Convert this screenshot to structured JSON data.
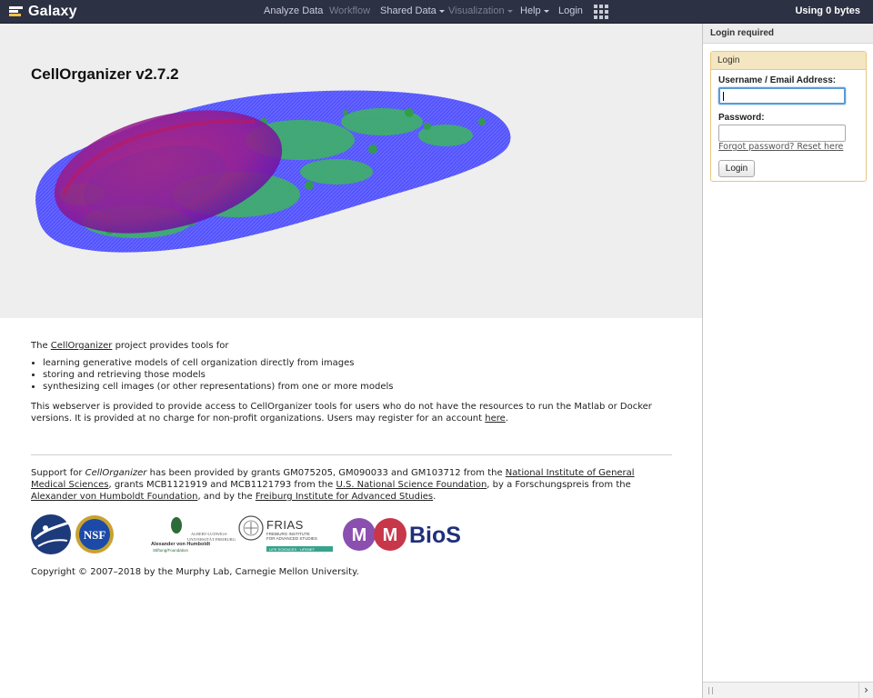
{
  "masthead": {
    "brand": "Galaxy",
    "nav": [
      {
        "label": "Analyze Data",
        "disabled": false,
        "dropdown": false
      },
      {
        "label": "Workflow",
        "disabled": true,
        "dropdown": false
      },
      {
        "label": "Shared Data",
        "disabled": false,
        "dropdown": true
      },
      {
        "label": "Visualization",
        "disabled": true,
        "dropdown": true
      },
      {
        "label": "Help",
        "disabled": false,
        "dropdown": true
      },
      {
        "label": "Login",
        "disabled": false,
        "dropdown": false
      }
    ],
    "quota": "Using 0 bytes",
    "colors": {
      "bar": "#2c3143",
      "brand_accent": "#f6c244"
    }
  },
  "hero": {
    "title": "CellOrganizer v2.7.2"
  },
  "intro": {
    "lead_before": "The ",
    "lead_link": "CellOrganizer",
    "lead_after": " project provides tools for",
    "bullets": [
      "learning generative models of cell organization directly from images",
      "storing and retrieving those models",
      "synthesizing cell images (or other representations) from one or more models"
    ],
    "para2_before": "This webserver is provided to provide access to CellOrganizer tools for users who do not have the resources to run the Matlab or Docker versions. It is provided at no charge for non-profit organizations. Users may register for an account ",
    "para2_link": "here",
    "para2_after": "."
  },
  "support": {
    "t1": "Support for ",
    "t1_em": "CellOrganizer",
    "t2": " has been provided by grants GM075205, GM090033 and GM103712 from the ",
    "link1": "National Institute of General Medical Sciences",
    "t3": ", grants MCB1121919 and MCB1121793 from the ",
    "link2": "U.S. National Science Foundation",
    "t4": ", by a Forschungspreis from the ",
    "link3": "Alexander von Humboldt Foundation",
    "t5": ", and by the ",
    "link4": "Freiburg Institute for Advanced Studies",
    "t6": "."
  },
  "logos": {
    "nsf": "NSF",
    "humboldt_name": "Alexander von Humboldt",
    "humboldt_sub": "Stiftung/Foundation",
    "albert1": "ALBERT-LUDWIGS-",
    "albert2": "UNIVERSITÄT FREIBURG",
    "frias": "FRIAS",
    "frias_sub1": "FREIBURG INSTITUTE",
    "frias_sub2": "FOR ADVANCED STUDIES",
    "frias_band": "LIFE SCIENCES · LIFENET",
    "mm_m1": "M",
    "mm_m2": "M",
    "mm_bios": "BioS"
  },
  "copyright": "Copyright © 2007–2018 by the Murphy Lab, Carnegie Mellon University.",
  "right_panel": {
    "header": "Login required",
    "box_title": "Login",
    "username_label": "Username / Email Address:",
    "username_value": "",
    "password_label": "Password:",
    "password_value": "",
    "forgot": "Forgot password? Reset here",
    "login_button": "Login"
  }
}
